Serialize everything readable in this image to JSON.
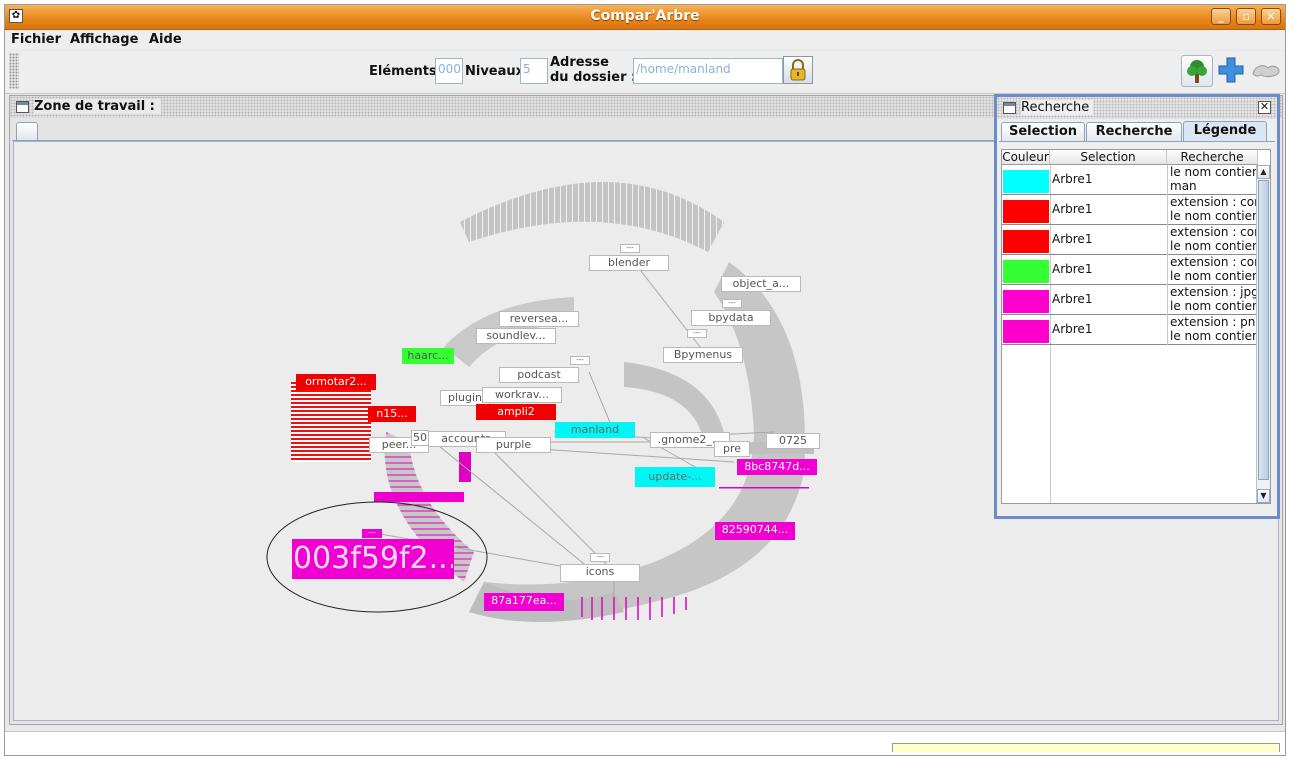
{
  "window": {
    "title": "Compar'Arbre"
  },
  "menu": {
    "items": [
      "Fichier",
      "Affichage",
      "Aide"
    ]
  },
  "toolbar": {
    "elements_label": "Eléments",
    "elements_value": "000",
    "levels_label": "Niveaux",
    "levels_value": "5",
    "address_label_line1": "Adresse",
    "address_label_line2": "du dossier :",
    "address_value": "/home/manland",
    "icons": [
      "lock-icon",
      "tree-icon",
      "plus-icon",
      "compare-icon"
    ]
  },
  "workzone": {
    "title": "Zone de travail :"
  },
  "graph": {
    "nodes": {
      "blender": "blender",
      "object_a": "object_a...",
      "bpydata": "bpydata",
      "bpymenus": "Bpymenus",
      "reversea": "reversea...",
      "soundlev": "soundlev...",
      "haarc": "haarc...",
      "ormotar": "ormotar2...",
      "podcast": "podcast",
      "plugin": "plugin",
      "workrav": "workrav...",
      "ampli": "ampli2",
      "n15": "n15...",
      "accounts": "accounts",
      "peer": "peer...",
      "n50": "50",
      "purple": "purple",
      "manland": "manland",
      "gnome2": ".gnome2_...",
      "n0725": "0725",
      "pre": "pre",
      "h8bc": "8bc8747d...",
      "update": "update-...",
      "h825": "82590744...",
      "h003": "003f59f2...",
      "icons": "icons",
      "h87a": "87a177ea...",
      "dash": "---"
    }
  },
  "search_panel": {
    "title": "Recherche",
    "tabs": [
      "Selection",
      "Recherche",
      "Légende"
    ],
    "active_tab": "Légende",
    "columns": [
      "Couleur",
      "Selection",
      "Recherche"
    ],
    "rows": [
      {
        "color": "#00ffff",
        "selection": "Arbre1",
        "recherche_line1": "le nom contient",
        "recherche_line2": "man"
      },
      {
        "color": "#ff0000",
        "selection": "Arbre1",
        "recherche_line1": "extension : cor",
        "recherche_line2": "le nom contient"
      },
      {
        "color": "#ff0000",
        "selection": "Arbre1",
        "recherche_line1": "extension : cor",
        "recherche_line2": "le nom contient"
      },
      {
        "color": "#33ff33",
        "selection": "Arbre1",
        "recherche_line1": "extension : cor",
        "recherche_line2": "le nom contient"
      },
      {
        "color": "#ff00cc",
        "selection": "Arbre1",
        "recherche_line1": "extension : jpg",
        "recherche_line2": "le nom contient"
      },
      {
        "color": "#ff00cc",
        "selection": "Arbre1",
        "recherche_line1": "extension : pn(",
        "recherche_line2": "le nom contient"
      }
    ]
  }
}
